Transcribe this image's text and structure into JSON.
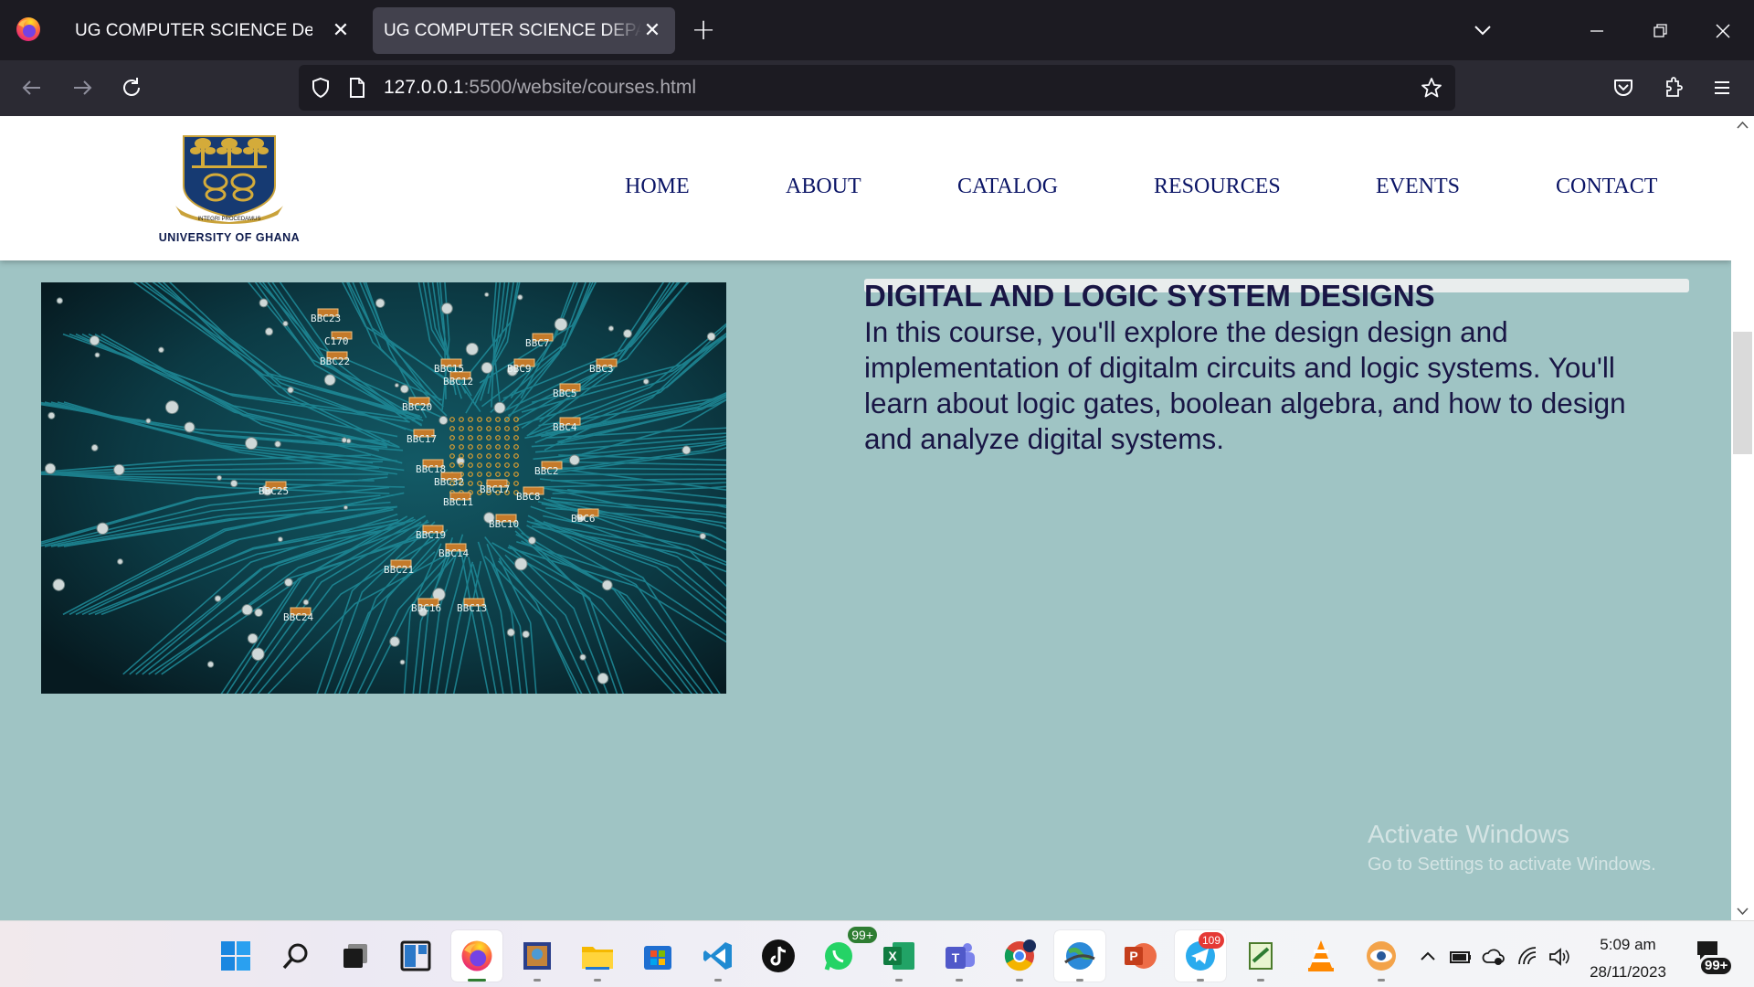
{
  "browser": {
    "tabs": [
      {
        "title": "UG COMPUTER SCIENCE Dept.",
        "active": false
      },
      {
        "title": "UG COMPUTER SCIENCE DEPARTMENT",
        "active": true
      }
    ],
    "url_host": "127.0.0.1",
    "url_rest": ":5500/website/courses.html",
    "icons": [
      "firefox-icon",
      "close-icon",
      "plus-icon",
      "chevron-down-icon",
      "minimize-icon",
      "restore-icon",
      "back-icon",
      "forward-icon",
      "reload-icon",
      "shield-icon",
      "page-icon",
      "star-icon",
      "pocket-icon",
      "extensions-icon",
      "menu-icon"
    ]
  },
  "site": {
    "logo_caption": "UNIVERSITY OF GHANA",
    "logo_motto": "INTEGRI PROCEDAMUS",
    "nav": [
      "HOME",
      "ABOUT",
      "CATALOG",
      "RESOURCES",
      "EVENTS",
      "CONTACT"
    ],
    "nav_color": "#0b1566",
    "course": {
      "title": "DIGITAL AND LOGIC SYSTEM DESIGNS",
      "description": "In this course, you'll explore the design design and implementation of digitalm circuits and logic systems. You'll learn about logic gates, boolean algebra, and how to design and analyze digital systems.",
      "image_alt": "circuit board",
      "board_labels": [
        "BBC23",
        "C170",
        "BBC22",
        "BBC15",
        "BBC12",
        "BBC9",
        "BBC7",
        "BBC5",
        "BBC4",
        "BBC3",
        "BBC20",
        "BBC17",
        "BBC18",
        "BBC32",
        "BBC11",
        "BBC17",
        "BBC8",
        "BBC2",
        "BBC25",
        "BBC19",
        "BBC14",
        "BBC10",
        "BBC6",
        "BBC21",
        "BBC24",
        "BBC16",
        "BBC13"
      ]
    },
    "background_color": "#9fc4c4"
  },
  "watermark": {
    "line1": "Activate Windows",
    "line2": "Go to Settings to activate Windows."
  },
  "taskbar": {
    "apps": [
      "windows-start-icon",
      "search-icon",
      "task-view-icon",
      "widgets-icon",
      "firefox-icon",
      "photo-app-icon",
      "file-explorer-icon",
      "microsoft-store-icon",
      "vscode-icon",
      "tiktok-icon",
      "whatsapp-icon",
      "excel-icon",
      "teams-icon",
      "chrome-icon",
      "globe-app-icon",
      "powerpoint-icon",
      "telegram-icon",
      "notepad-icon",
      "vlc-icon",
      "eye-app-icon"
    ],
    "whatsapp_badge": "99+",
    "telegram_badge": "109",
    "time": "5:09 am",
    "date": "28/11/2023",
    "notification_badge": "99+"
  }
}
